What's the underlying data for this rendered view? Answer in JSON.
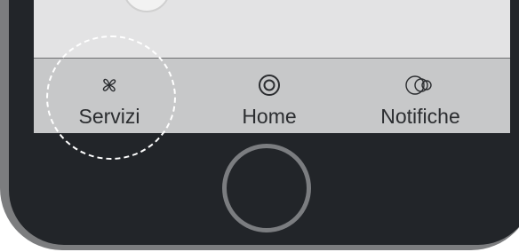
{
  "tab_bar": {
    "tabs": [
      {
        "label": "Servizi",
        "icon": "flower-icon"
      },
      {
        "label": "Home",
        "icon": "target-icon"
      },
      {
        "label": "Notifiche",
        "icon": "overlapping-circles-icon"
      }
    ]
  },
  "colors": {
    "phone_frame": "#7c7d7f",
    "phone_body": "#222529",
    "screen": "#e3e3e4",
    "tab_bar": "#c7c8c9",
    "tab_text": "#2b2d30",
    "highlight": "#ffffff"
  }
}
